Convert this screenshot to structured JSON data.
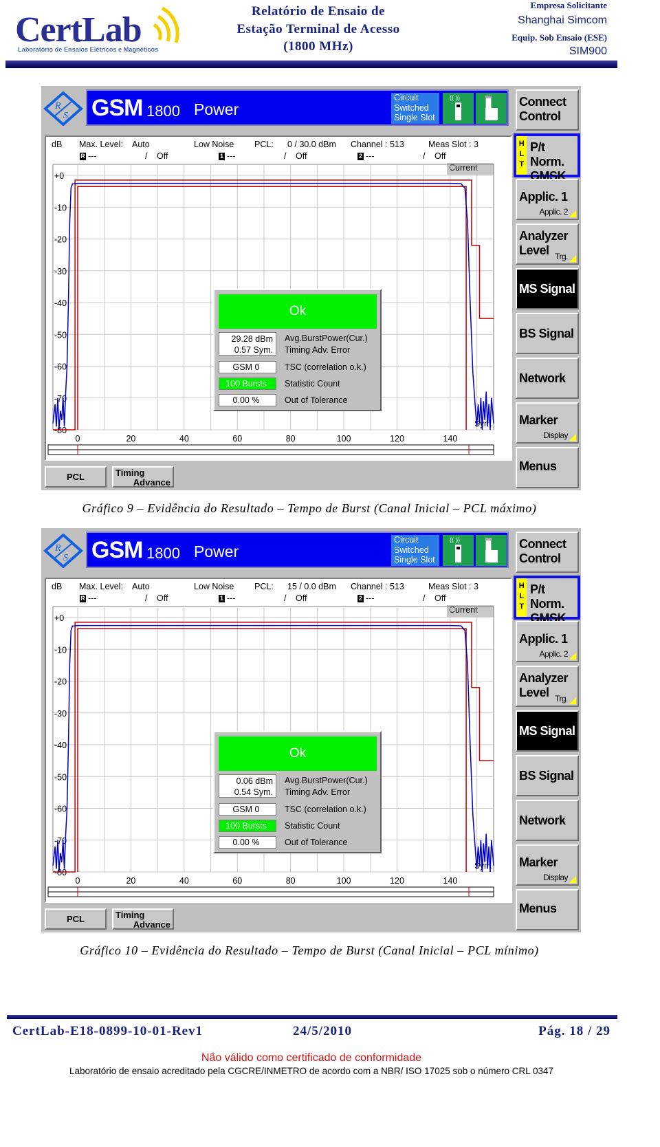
{
  "header": {
    "logo_text": "CertLab",
    "logo_subtitle": "Laboratório de Ensaios Elétricos e Magnéticos",
    "title_lines": [
      "Relatório de Ensaio de",
      "Estação Terminal de Acesso",
      "(1800 MHz)"
    ],
    "company_label": "Empresa Solicitante",
    "company": "Shanghai Simcom",
    "equipment_label": "Equip. Sob Ensaio (ESE)",
    "equipment": "SIM900"
  },
  "screens": [
    {
      "system": "GSM",
      "band": "1800",
      "measurement": "Power",
      "mode_lines": [
        "Circuit",
        "Switched",
        "Single Slot"
      ],
      "y_unit": "dB",
      "max_level_label": "Max. Level:",
      "max_level": "Auto",
      "noise": "Low Noise",
      "pcl_label": "PCL:",
      "pcl": "0 / 30.0 dBm",
      "channel": "Channel : 513",
      "meas_slot": "Meas Slot : 3",
      "markers": [
        {
          "id": "R",
          "value": "---",
          "state": "Off"
        },
        {
          "id": "1",
          "value": "---",
          "state": "Off"
        },
        {
          "id": "2",
          "value": "---",
          "state": "Off"
        }
      ],
      "trace_label": "Current",
      "ok_label": "Ok",
      "results": {
        "avg_power": "29.28  dBm",
        "timing_error": "0.57  Sym.",
        "tsc": "GSM 0",
        "stat_count": "100 Bursts",
        "out_of_tol": "0.00  %"
      },
      "result_labels": [
        "Avg.BurstPower(Cur.)",
        "Timing Adv. Error",
        "TSC (correlation o.k.)",
        "Statistic Count",
        "Out of Tolerance"
      ],
      "x_unit_label": "Sym.",
      "caption": "Gráfico 9 – Evidência do Resultado – Tempo de Burst (Canal Inicial – PCL máximo)"
    },
    {
      "system": "GSM",
      "band": "1800",
      "measurement": "Power",
      "mode_lines": [
        "Circuit",
        "Switched",
        "Single Slot"
      ],
      "y_unit": "dB",
      "max_level_label": "Max. Level:",
      "max_level": "Auto",
      "noise": "Low Noise",
      "pcl_label": "PCL:",
      "pcl": "15 / 0.0 dBm",
      "channel": "Channel : 513",
      "meas_slot": "Meas Slot : 3",
      "markers": [
        {
          "id": "R",
          "value": "---",
          "state": "Off"
        },
        {
          "id": "1",
          "value": "---",
          "state": "Off"
        },
        {
          "id": "2",
          "value": "---",
          "state": "Off"
        }
      ],
      "trace_label": "Current",
      "ok_label": "Ok",
      "results": {
        "avg_power": "0.06  dBm",
        "timing_error": "0.54  Sym.",
        "tsc": "GSM 0",
        "stat_count": "100 Bursts",
        "out_of_tol": "0.00  %"
      },
      "result_labels": [
        "Avg.BurstPower(Cur.)",
        "Timing Adv. Error",
        "TSC (correlation o.k.)",
        "Statistic Count",
        "Out of Tolerance"
      ],
      "x_unit_label": "Sym.",
      "caption": "Gráfico 10 – Evidência do Resultado – Tempo de Burst (Canal Inicial – PCL mínimo)"
    }
  ],
  "plot": {
    "y_ticks": [
      "+0",
      "-10",
      "-20",
      "-30",
      "-40",
      "-50",
      "-60",
      "-70",
      "-80"
    ],
    "y_values": [
      0,
      -10,
      -20,
      -30,
      -40,
      -50,
      -60,
      -70,
      -80
    ],
    "x_ticks": [
      0,
      20,
      40,
      60,
      80,
      100,
      120,
      140
    ],
    "x_range": [
      -9.3,
      156.3
    ],
    "y_range": [
      -80,
      0
    ],
    "grid": true,
    "limit_line_color": "#c00000",
    "trace_color": "#0000c0",
    "upper_limit": [
      [
        -9.3,
        -80
      ],
      [
        -1,
        -80
      ],
      [
        -1,
        -1.5
      ],
      [
        148,
        -1.5
      ],
      [
        148,
        -22
      ],
      [
        151,
        -22
      ],
      [
        151,
        -45
      ],
      [
        156.3,
        -45
      ]
    ],
    "lower_limit": [
      [
        0,
        -80
      ],
      [
        0,
        -3.5
      ],
      [
        146,
        -3.5
      ],
      [
        146,
        -80
      ]
    ],
    "trace": [
      [
        -9.3,
        -78
      ],
      [
        -8.5,
        -72
      ],
      [
        -8,
        -79
      ],
      [
        -7.5,
        -70
      ],
      [
        -7,
        -80
      ],
      [
        -6.5,
        -74
      ],
      [
        -6,
        -77
      ],
      [
        -5.5,
        -70
      ],
      [
        -5,
        -79
      ],
      [
        -4.5,
        -68
      ],
      [
        -4,
        -60
      ],
      [
        -3.5,
        -40
      ],
      [
        -3,
        -15
      ],
      [
        -2.5,
        -4
      ],
      [
        -2,
        -2.7
      ],
      [
        0,
        -2.5
      ],
      [
        140,
        -2.5
      ],
      [
        144,
        -2.6
      ],
      [
        145.5,
        -4
      ],
      [
        146.5,
        -15
      ],
      [
        147.5,
        -40
      ],
      [
        148.5,
        -62
      ],
      [
        149.5,
        -74
      ],
      [
        150,
        -79
      ],
      [
        150.5,
        -72
      ],
      [
        151,
        -78
      ],
      [
        151.5,
        -70
      ],
      [
        152,
        -80
      ],
      [
        152.5,
        -71
      ],
      [
        153,
        -77
      ],
      [
        153.5,
        -68
      ],
      [
        154,
        -79
      ],
      [
        154.5,
        -72
      ],
      [
        155,
        -80
      ],
      [
        155.5,
        -70
      ],
      [
        156.3,
        -78
      ]
    ]
  },
  "softkeys": {
    "connect_control": [
      "Connect",
      "Control"
    ],
    "hlt": [
      "H",
      "L",
      "T"
    ],
    "ptnorm": [
      "P/t Norm.",
      "GMSK"
    ],
    "applic": "Applic. 1",
    "applic_sub": "Applic. 2",
    "analyzer": [
      "Analyzer",
      "Level"
    ],
    "analyzer_sub": "Trg.",
    "ms_signal": "MS Signal",
    "bs_signal": "BS Signal",
    "network": "Network",
    "marker": "Marker",
    "marker_sub": "Display",
    "menus": "Menus",
    "pcl": "PCL",
    "timing": [
      "Timing",
      "Advance"
    ]
  },
  "footer": {
    "doc_id": "CertLab-E18-0899-10-01-Rev1",
    "date": "24/5/2010",
    "page": "Pág. 18 / 29",
    "notice": "Não válido como certificado de conformidade",
    "accreditation": "Laboratório de ensaio acreditado pela CGCRE/INMETRO de acordo com a NBR/ ISO 17025 sob o número CRL 0347"
  }
}
